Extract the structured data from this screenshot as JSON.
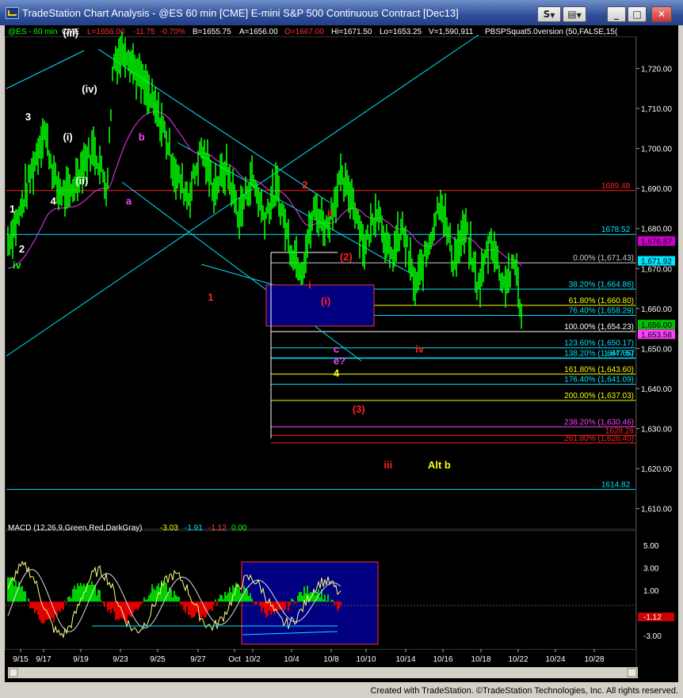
{
  "window": {
    "title": "TradeStation Chart Analysis - @ES 60 min [CME] E-mini S&P 500 Continuous Contract [Dec13]",
    "buttons": [
      "S",
      "▼",
      "▼",
      "_",
      "□",
      "✕"
    ]
  },
  "legend": {
    "symbol": "@ES - 60 min",
    "exchange": "CME",
    "last": "L=1656.00",
    "change": "-11.75",
    "pct": "-0.70%",
    "bid": "B=1655.75",
    "ask": "A=1656.00",
    "open": "O=1667.00",
    "high": "Hi=1671.50",
    "low": "Lo=1653.25",
    "volume": "V=1,590,911",
    "study": "PBSPSquat5.0version (50,FALSE,15("
  },
  "macd_legend": {
    "label": "MACD (12,26,9,Green,Red,DarkGray)",
    "v1": "-3.03",
    "v2": "-1.91",
    "v3": "-1.12",
    "v4": "0.00"
  },
  "status": "Created with TradeStation. ©TradeStation Technologies, Inc. All rights reserved.",
  "colors": {
    "price": "#00ff00",
    "cyan": "#00e5ff",
    "magenta": "#cc33cc",
    "red": "#ff2020",
    "yellow": "#ffff00",
    "navy": "#000080"
  },
  "chart_data": {
    "type": "line",
    "title": "",
    "price_axis": {
      "ylim": [
        1605,
        1728
      ],
      "ticks": [
        "1,720.00",
        "1,710.00",
        "1,700.00",
        "1,690.00",
        "1,680.00",
        "1,670.00",
        "1,660.00",
        "1,650.00",
        "1,640.00",
        "1,630.00",
        "1,620.00",
        "1,610.00"
      ],
      "tick_values": [
        1720,
        1710,
        1700,
        1690,
        1680,
        1670,
        1660,
        1650,
        1640,
        1630,
        1620,
        1610
      ]
    },
    "date_axis": {
      "ticks": [
        "9/15",
        "9/17",
        "9/19",
        "9/23",
        "9/25",
        "9/27",
        "Oct",
        "10/2",
        "10/4",
        "10/8",
        "10/10",
        "10/14",
        "10/16",
        "10/18",
        "10/22",
        "10/24",
        "10/28"
      ]
    },
    "price_path": [
      [
        0,
        1676
      ],
      [
        0.02,
        1683
      ],
      [
        0.04,
        1694
      ],
      [
        0.06,
        1705
      ],
      [
        0.08,
        1690
      ],
      [
        0.1,
        1688
      ],
      [
        0.12,
        1696
      ],
      [
        0.14,
        1700
      ],
      [
        0.16,
        1690
      ],
      [
        0.17,
        1722
      ],
      [
        0.19,
        1725
      ],
      [
        0.21,
        1718
      ],
      [
        0.23,
        1712
      ],
      [
        0.25,
        1705
      ],
      [
        0.27,
        1693
      ],
      [
        0.29,
        1688
      ],
      [
        0.31,
        1700
      ],
      [
        0.33,
        1690
      ],
      [
        0.35,
        1695
      ],
      [
        0.37,
        1683
      ],
      [
        0.39,
        1693
      ],
      [
        0.41,
        1683
      ],
      [
        0.43,
        1690
      ],
      [
        0.45,
        1676
      ],
      [
        0.47,
        1670
      ],
      [
        0.49,
        1685
      ],
      [
        0.51,
        1680
      ],
      [
        0.53,
        1692
      ],
      [
        0.55,
        1688
      ],
      [
        0.57,
        1675
      ],
      [
        0.59,
        1686
      ],
      [
        0.61,
        1672
      ],
      [
        0.63,
        1680
      ],
      [
        0.65,
        1665
      ],
      [
        0.67,
        1675
      ],
      [
        0.69,
        1688
      ],
      [
        0.71,
        1672
      ],
      [
        0.73,
        1680
      ],
      [
        0.75,
        1665
      ],
      [
        0.77,
        1678
      ],
      [
        0.79,
        1666
      ],
      [
        0.81,
        1671
      ],
      [
        0.82,
        1656
      ]
    ],
    "horizontal_levels": [
      {
        "label": "1689.48",
        "value": 1689.48,
        "color": "red"
      },
      {
        "label": "1678.52",
        "value": 1678.52,
        "color": "cyan"
      },
      {
        "label": "1614.82",
        "value": 1614.82,
        "color": "cyan"
      },
      {
        "label": "1,647.57",
        "value": 1647.57,
        "color": "cyan"
      }
    ],
    "fib_levels": [
      {
        "label": "0.00% (1,671.43)",
        "value": 1671.43,
        "color": "#cccccc"
      },
      {
        "label": "38.20% (1,664.86)",
        "value": 1664.86,
        "color": "#00e5ff"
      },
      {
        "label": "61.80% (1,660.80)",
        "value": 1660.8,
        "color": "#ffff00"
      },
      {
        "label": "76.40% (1,658.29)",
        "value": 1658.29,
        "color": "#00e5ff"
      },
      {
        "label": "100.00% (1,654.23)",
        "value": 1654.23,
        "color": "#ffffff"
      },
      {
        "label": "123.60% (1,650.17)",
        "value": 1650.17,
        "color": "#00e5ff"
      },
      {
        "label": "138.20% (1,647.66)",
        "value": 1647.66,
        "color": "#00e5ff"
      },
      {
        "label": "161.80% (1,643.60)",
        "value": 1643.6,
        "color": "#ffff00"
      },
      {
        "label": "176.40% (1,641.09)",
        "value": 1641.09,
        "color": "#00e5ff"
      },
      {
        "label": "200.00% (1,637.03)",
        "value": 1637.03,
        "color": "#ffff00"
      },
      {
        "label": "238.20% (1,630.46)",
        "value": 1630.46,
        "color": "#ff40ff"
      },
      {
        "label": "261.80% (1,626.40)",
        "value": 1626.4,
        "color": "#ff2020"
      },
      {
        "label": "1628.28",
        "value": 1628.28,
        "color": "#ff2020"
      }
    ],
    "price_tags": [
      {
        "label": "1,676.87",
        "value": 1676.87,
        "color": "#cc00cc"
      },
      {
        "label": "1,671.92",
        "value": 1671.92,
        "color": "#00e5ff"
      },
      {
        "label": "1,656.00",
        "value": 1656.0,
        "color": "#00c000"
      },
      {
        "label": "1,653.58",
        "value": 1653.58,
        "color": "#ff40ff"
      }
    ],
    "wave_labels": [
      {
        "text": "iv",
        "color": "#00ff00",
        "x": 0.01,
        "y": 1670
      },
      {
        "text": "1",
        "color": "#ffffff",
        "x": 0.005,
        "y": 1684
      },
      {
        "text": "2",
        "color": "#ffffff",
        "x": 0.02,
        "y": 1674
      },
      {
        "text": "3",
        "color": "#ffffff",
        "x": 0.03,
        "y": 1707
      },
      {
        "text": "4",
        "color": "#ffffff",
        "x": 0.07,
        "y": 1686
      },
      {
        "text": "(i)",
        "color": "#ffffff",
        "x": 0.09,
        "y": 1702
      },
      {
        "text": "(ii)",
        "color": "#ffffff",
        "x": 0.11,
        "y": 1691
      },
      {
        "text": "(iii)",
        "color": "#ffffff",
        "x": 0.09,
        "y": 1728
      },
      {
        "text": "(iv)",
        "color": "#ffffff",
        "x": 0.12,
        "y": 1714
      },
      {
        "text": "b",
        "color": "#ff40ff",
        "x": 0.21,
        "y": 1702
      },
      {
        "text": "a",
        "color": "#ff40ff",
        "x": 0.19,
        "y": 1686
      },
      {
        "text": "1",
        "color": "#ff2020",
        "x": 0.32,
        "y": 1662
      },
      {
        "text": "2",
        "color": "#ff2020",
        "x": 0.47,
        "y": 1690
      },
      {
        "text": "ii",
        "color": "#ff2020",
        "x": 0.51,
        "y": 1683
      },
      {
        "text": "(2)",
        "color": "#ff2020",
        "x": 0.53,
        "y": 1672
      },
      {
        "text": "i",
        "color": "#ff2020",
        "x": 0.48,
        "y": 1665
      },
      {
        "text": "(i)",
        "color": "#ff2020",
        "x": 0.5,
        "y": 1661
      },
      {
        "text": "c",
        "color": "#ff40ff",
        "x": 0.52,
        "y": 1649
      },
      {
        "text": "e?",
        "color": "#ff40ff",
        "x": 0.52,
        "y": 1646
      },
      {
        "text": "4",
        "color": "#ffff00",
        "x": 0.52,
        "y": 1643
      },
      {
        "text": "iv",
        "color": "#ff2020",
        "x": 0.65,
        "y": 1649
      },
      {
        "text": "(3)",
        "color": "#ff2020",
        "x": 0.55,
        "y": 1634
      },
      {
        "text": "iii",
        "color": "#ff2020",
        "x": 0.6,
        "y": 1620
      },
      {
        "text": "Alt b",
        "color": "#ffff00",
        "x": 0.67,
        "y": 1620
      }
    ],
    "macd_axis": {
      "ticks": [
        "5.00",
        "3.00",
        "1.00",
        "-1.12",
        "-3.00"
      ],
      "ylim": [
        -4.2,
        6.2
      ]
    }
  }
}
